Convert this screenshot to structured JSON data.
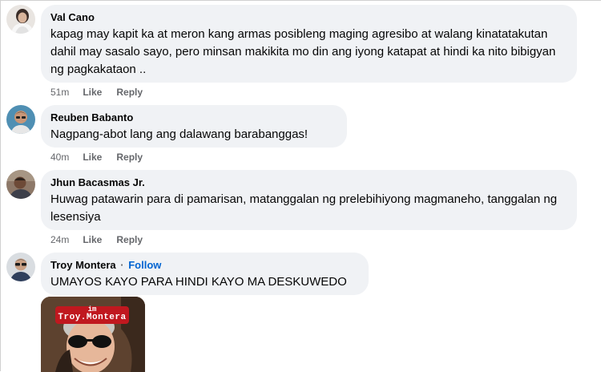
{
  "comments": [
    {
      "author": "Val Cano",
      "text": "kapag may kapit ka at meron kang armas posibleng maging agresibo at walang kinatatakutan dahil may sasalo sayo, pero minsan makikita mo din ang iyong katapat at hindi ka nito bibigyan ng pagkakataon ..",
      "time": "51m",
      "like_label": "Like",
      "reply_label": "Reply"
    },
    {
      "author": "Reuben Babanto",
      "text": "Nagpang-abot lang ang dalawang barabanggas!",
      "time": "40m",
      "like_label": "Like",
      "reply_label": "Reply"
    },
    {
      "author": "Jhun Bacasmas Jr.",
      "text": "Huwag patawarin para di pamarisan, matanggalan ng prelebihiyong magmaneho, tanggalan ng lesensiya",
      "time": "24m",
      "like_label": "Like",
      "reply_label": "Reply"
    },
    {
      "author": "Troy Montera",
      "follow_separator": "·",
      "follow_label": "Follow",
      "text": "UMAYOS KAYO PARA HINDI KAYO MA DESKUWEDO",
      "attachment": {
        "tag_small": "im",
        "tag_name": "Troy.Montera"
      }
    }
  ],
  "colors": {
    "bubble": "#f0f2f5",
    "text": "#050505",
    "meta": "#65676b",
    "follow": "#0064d1",
    "sticker_tag": "#c0181f"
  },
  "icons": [
    "avatar-val-cano",
    "avatar-reuben-babanto",
    "avatar-jhun-bacasmas",
    "avatar-troy-montera",
    "sticker-photo"
  ]
}
